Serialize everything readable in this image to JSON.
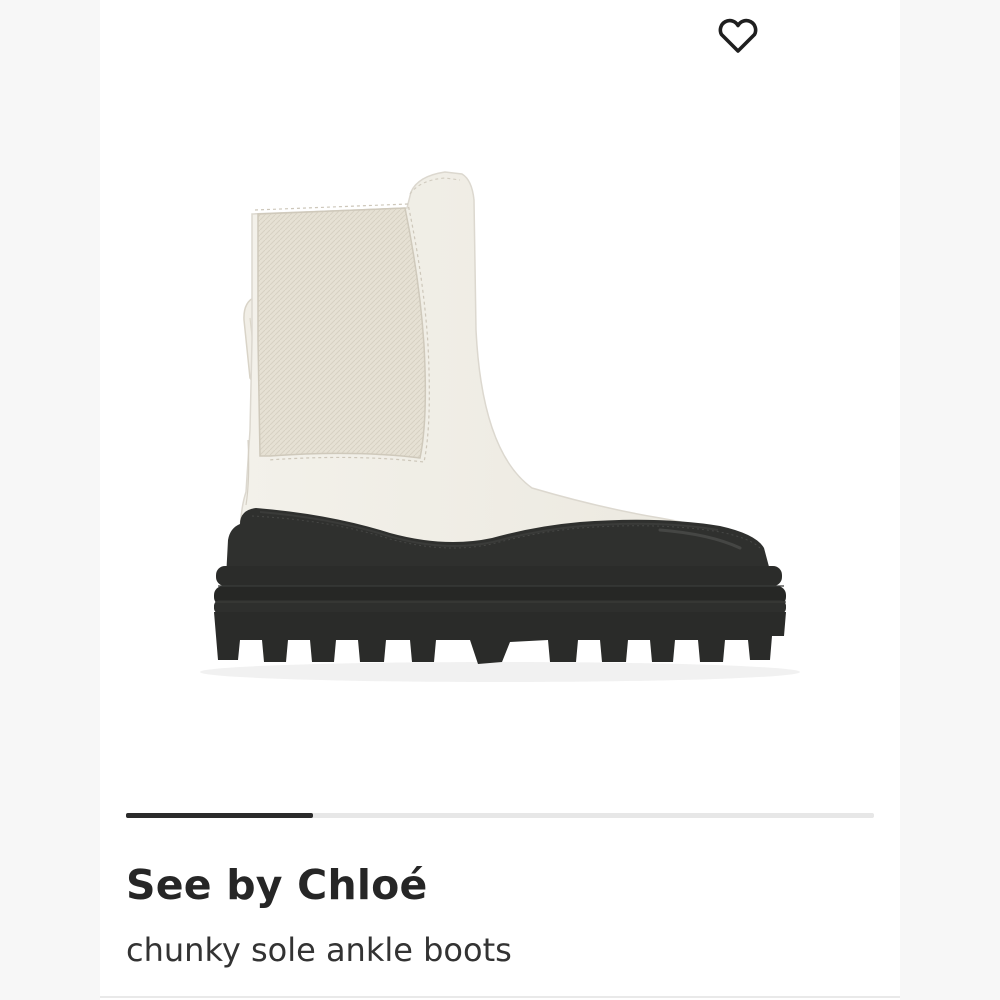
{
  "product": {
    "brand": "See by Chloé",
    "name": "chunky sole ankle boots"
  },
  "icons": {
    "favorite": "heart-outline-icon"
  },
  "carousel": {
    "progress_fraction": 0.25
  },
  "colors": {
    "text_primary": "#262626",
    "indicator_active": "#2b2b2b",
    "indicator_track": "#e7e7e7",
    "boot_upper": "#f0ede5",
    "boot_sole": "#2c2d2b"
  }
}
